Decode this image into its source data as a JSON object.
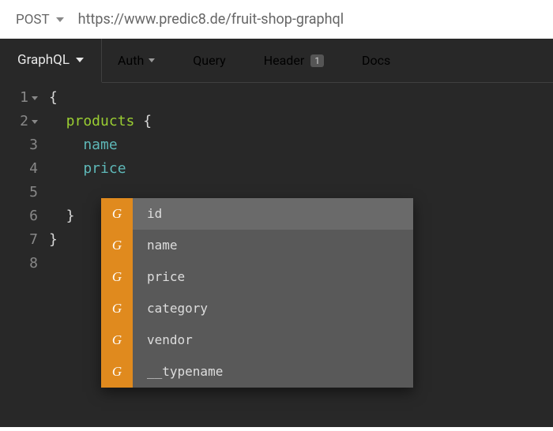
{
  "request": {
    "method": "POST",
    "url": "https://www.predic8.de/fruit-shop-graphql"
  },
  "tabs": {
    "active": "GraphQL",
    "items": [
      {
        "label": "Auth",
        "hasDropdown": true
      },
      {
        "label": "Query"
      },
      {
        "label": "Header",
        "badge": "1"
      },
      {
        "label": "Docs"
      }
    ]
  },
  "editor": {
    "lines": [
      {
        "num": "1",
        "fold": true,
        "tokens": [
          {
            "cls": "tok-brace",
            "text": "{"
          }
        ]
      },
      {
        "num": "2",
        "fold": true,
        "tokens": [
          {
            "cls": "tok-field",
            "text": "  products "
          },
          {
            "cls": "tok-brace",
            "text": "{"
          }
        ]
      },
      {
        "num": "3",
        "tokens": [
          {
            "cls": "tok-prop",
            "text": "    name"
          }
        ]
      },
      {
        "num": "4",
        "tokens": [
          {
            "cls": "tok-prop",
            "text": "    price"
          }
        ]
      },
      {
        "num": "5",
        "tokens": []
      },
      {
        "num": "6",
        "tokens": [
          {
            "cls": "tok-brace",
            "text": "  }"
          }
        ]
      },
      {
        "num": "7",
        "tokens": [
          {
            "cls": "tok-brace",
            "text": "}"
          }
        ]
      },
      {
        "num": "8",
        "tokens": []
      }
    ]
  },
  "autocomplete": {
    "iconGlyph": "G",
    "items": [
      {
        "label": "id",
        "highlighted": true
      },
      {
        "label": "name"
      },
      {
        "label": "price"
      },
      {
        "label": "category"
      },
      {
        "label": "vendor"
      },
      {
        "label": "__typename"
      }
    ]
  }
}
